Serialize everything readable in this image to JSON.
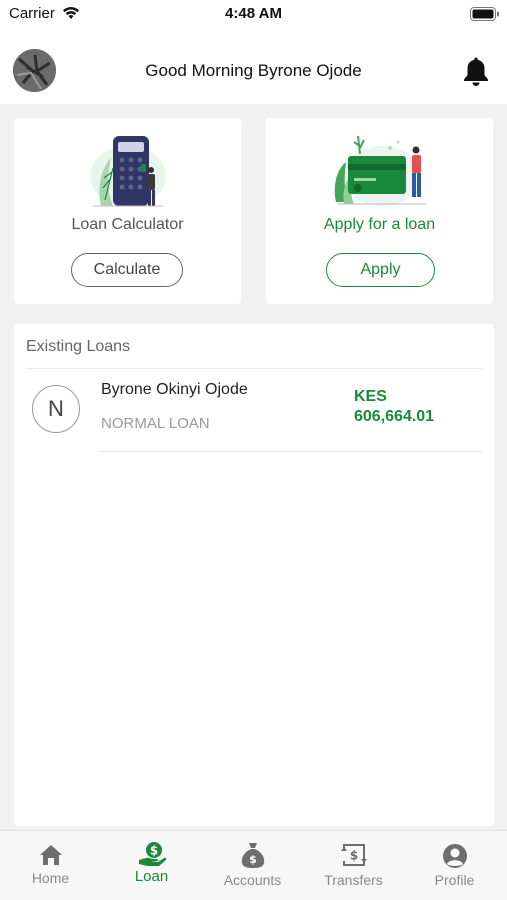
{
  "status_bar": {
    "carrier": "Carrier",
    "time": "4:48 AM"
  },
  "header": {
    "greeting": "Good Morning Byrone Ojode"
  },
  "cards": {
    "calculator": {
      "title": "Loan Calculator",
      "button": "Calculate"
    },
    "apply": {
      "title": "Apply for a loan",
      "button": "Apply"
    }
  },
  "loans": {
    "heading": "Existing Loans",
    "items": [
      {
        "initial": "N",
        "name": "Byrone Okinyi Ojode",
        "type": "NORMAL LOAN",
        "currency": "KES",
        "amount": "606,664.01"
      }
    ]
  },
  "tabs": [
    {
      "label": "Home",
      "icon": "home-icon",
      "active": false
    },
    {
      "label": "Loan",
      "icon": "loan-icon",
      "active": true
    },
    {
      "label": "Accounts",
      "icon": "money-bag-icon",
      "active": false
    },
    {
      "label": "Transfers",
      "icon": "transfer-icon",
      "active": false
    },
    {
      "label": "Profile",
      "icon": "profile-icon",
      "active": false
    }
  ],
  "colors": {
    "accent": "#1a8a3a",
    "text_muted": "#8a8a8a",
    "background": "#f1f1f1"
  }
}
